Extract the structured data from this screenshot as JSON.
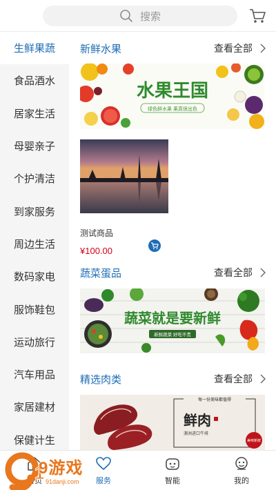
{
  "search": {
    "placeholder": "搜索"
  },
  "sidebar": {
    "items": [
      {
        "label": "生鲜果蔬",
        "active": true
      },
      {
        "label": "食品酒水"
      },
      {
        "label": "居家生活"
      },
      {
        "label": "母婴亲子"
      },
      {
        "label": "个护清洁"
      },
      {
        "label": "到家服务"
      },
      {
        "label": "周边生活"
      },
      {
        "label": "数码家电"
      },
      {
        "label": "服饰鞋包"
      },
      {
        "label": "运动旅行"
      },
      {
        "label": "汽车用品"
      },
      {
        "label": "家居建材"
      },
      {
        "label": "保健计生"
      }
    ]
  },
  "sections": [
    {
      "title": "新鲜水果",
      "more": "查看全部",
      "banner": {
        "title": "水果王国",
        "subtitle": "绿色鲜水果 果真很出色"
      }
    },
    {
      "title": "蔬菜蛋品",
      "more": "查看全部",
      "banner": {
        "title": "蔬菜就是要新鲜",
        "subtitle": "新鲜蔬菜 好吃不贵"
      }
    },
    {
      "title": "精选肉类",
      "more": "查看全部",
      "banner": {
        "title": "鲜肉",
        "line1": "每一份美味都值得",
        "line2": "澳洲进口牛排",
        "seal": "美味新鲜"
      }
    }
  ],
  "product": {
    "name": "测试商品",
    "price": "¥100.00"
  },
  "tabbar": {
    "items": [
      {
        "label": "首页"
      },
      {
        "label": "服务",
        "active": true
      },
      {
        "label": "智能"
      },
      {
        "label": "我的"
      }
    ]
  },
  "watermark": {
    "big": "9游戏",
    "small": "91danji.com"
  },
  "colors": {
    "accent": "#1e6db5",
    "price": "#d0021b",
    "sidebar_bg": "#f5f5f5"
  }
}
